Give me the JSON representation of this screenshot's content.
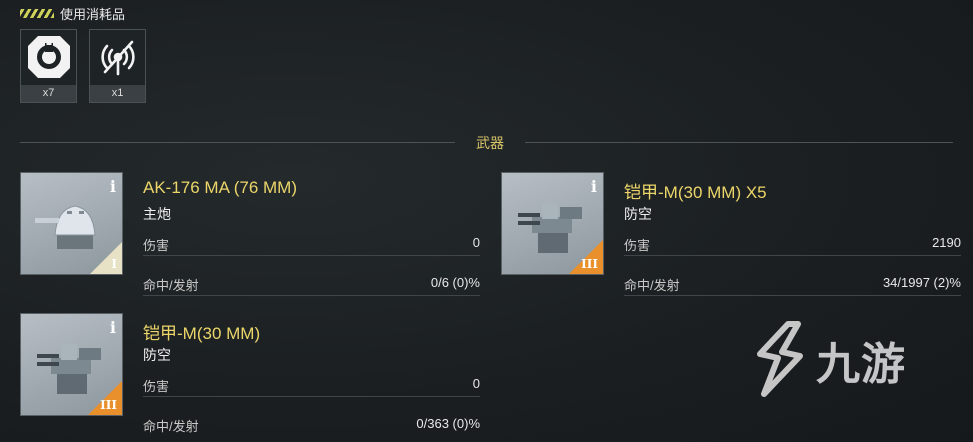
{
  "header": {
    "title": "使用消耗品"
  },
  "consumables": [
    {
      "icon": "repair-kit-icon",
      "count": "x7"
    },
    {
      "icon": "radar-jammer-icon",
      "count": "x1"
    }
  ],
  "section": {
    "title": "武器"
  },
  "weapons": [
    {
      "name": "AK-176 MA (76 MM)",
      "type": "主炮",
      "tier": "I",
      "stats": [
        {
          "label": "伤害",
          "value": "0"
        },
        {
          "label": "命中/发射",
          "value": "0/6 (0)%"
        }
      ]
    },
    {
      "name": "铠甲-M(30 MM) X5",
      "type": "防空",
      "tier": "III",
      "stats": [
        {
          "label": "伤害",
          "value": "2190"
        },
        {
          "label": "命中/发射",
          "value": "34/1997 (2)%"
        }
      ]
    },
    {
      "name": "铠甲-M(30 MM)",
      "type": "防空",
      "tier": "III",
      "stats": [
        {
          "label": "伤害",
          "value": "0"
        },
        {
          "label": "命中/发射",
          "value": "0/363 (0)%"
        }
      ]
    }
  ],
  "watermark": {
    "text": "九游",
    "icon": "jiuyou-logo-icon"
  },
  "colors": {
    "accent_yellow": "#ecd66a",
    "tier_orange": "#e98f2b",
    "tier_cream": "#e7e2c6"
  }
}
